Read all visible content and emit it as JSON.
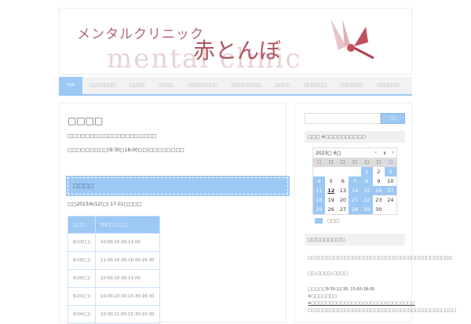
{
  "header": {
    "logo_kana": "メンタルクリニック",
    "logo_name": "赤とんぼ",
    "logo_en": "mental clinic"
  },
  "nav": [
    "TOP",
    "□□□□□□□",
    "□□□□",
    "□□□□",
    "□□□□□□□□",
    "□□□□□□□□",
    "□□□□",
    "□□□□□□",
    "□□□□□□",
    "□□□□□□"
  ],
  "main": {
    "title": "□□□□",
    "p1": "□□□□□□□□□□□□□□□□□□□□",
    "p2": "□□□□□□□□□(9:30□18:00□□)□□□□□□□□",
    "section": "□□□□",
    "updated": "□□2023/6/12(□) 17:01□□□□",
    "table": {
      "headers": [
        "□□□",
        "30□□□ □□"
      ],
      "rows": [
        [
          "6/13(□)",
          "10:00,10:30,11:00"
        ],
        [
          "6/19(□)",
          "11:00,15:30,16:00,16:30"
        ],
        [
          "6/20(□)",
          "10:00,10:30,11:00"
        ],
        [
          "6/23(□)",
          "10:00,10:30,15:30,16:30"
        ],
        [
          "6/24(□)",
          "10:30,11:00,15:30,16:30"
        ]
      ]
    }
  },
  "sidebar": {
    "search_button": "□□",
    "cal_title": "□□□ ※□□□□□□□□□□",
    "calendar": {
      "month": "2023□ 6□",
      "prev": "‹",
      "pause": "॥",
      "next": "›",
      "weekdays": [
        "□",
        "□",
        "□",
        "□",
        "□",
        "□",
        "□"
      ],
      "days": [
        "",
        "",
        "",
        "",
        "1",
        "2",
        "3",
        "4",
        "5",
        "6",
        "7",
        "8",
        "9",
        "10",
        "11",
        "12",
        "13",
        "14",
        "15",
        "16",
        "17",
        "18",
        "19",
        "20",
        "21",
        "22",
        "23",
        "24",
        "25",
        "26",
        "27",
        "28",
        "29",
        "30",
        ""
      ],
      "closed": [
        1,
        3,
        4,
        7,
        8,
        11,
        14,
        15,
        16,
        17,
        18,
        21,
        22,
        25,
        28,
        29
      ],
      "today": 12
    },
    "legend": "□□□",
    "info_title": "□□□□□□□□□",
    "info_lines": [
      "□□□□□□□□□□□□□□□□□□□□□□□□□□□□□□□□□□□□□□□",
      "□□-□□□□-□□□□",
      "□□□□□9:30-12:30, 15:00-18:00",
      "※□□□□□□□",
      "※□□□□□□□□□□□□□□□□□□□□□□□□□□□□",
      "□□□□□□□□□□□□□□□□□□□□□□□□□□□□□□□□□□□□□□□□"
    ]
  }
}
